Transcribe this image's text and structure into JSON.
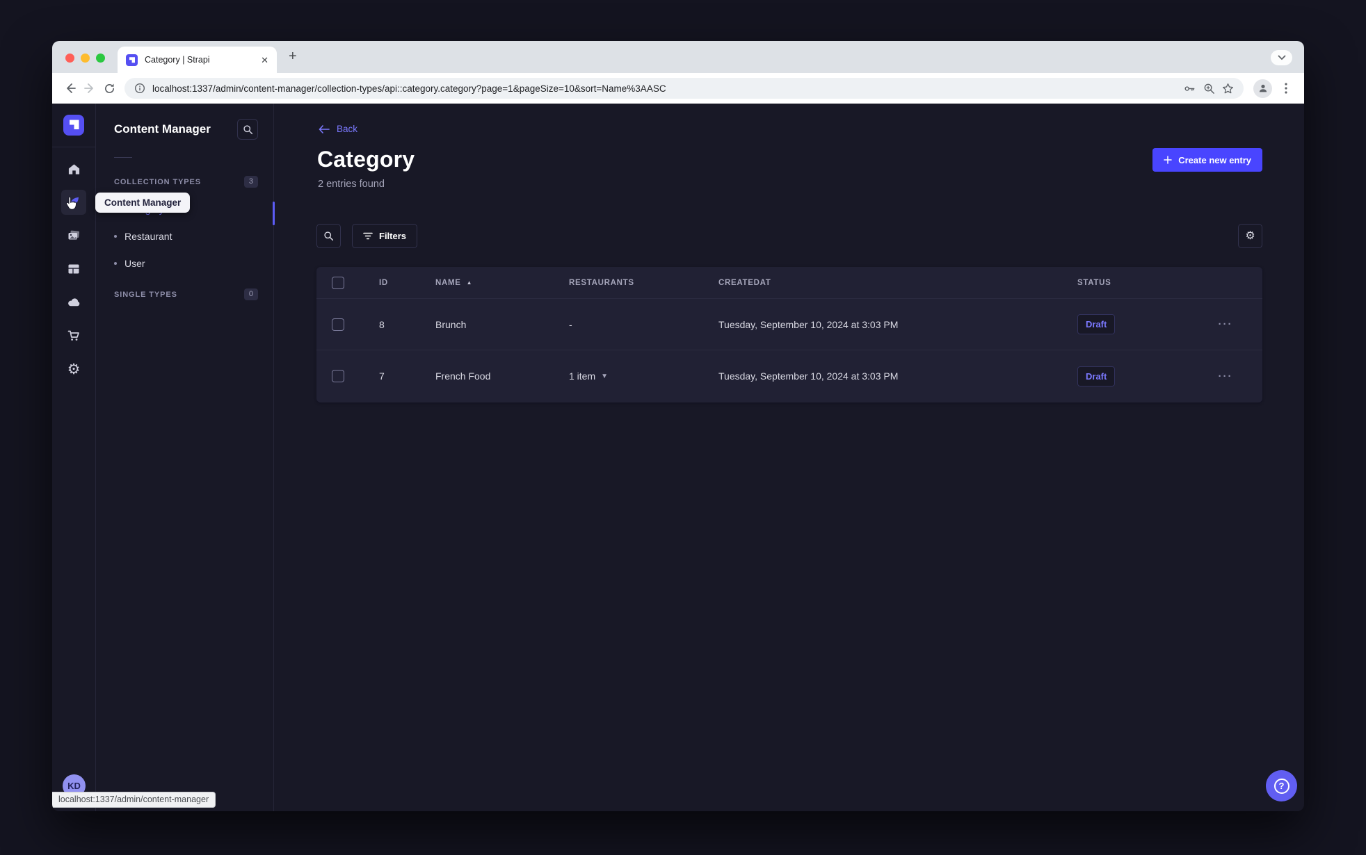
{
  "browser": {
    "tab_title": "Category | Strapi",
    "new_tab_label": "+",
    "close_tab_label": "✕",
    "url": "localhost:1337/admin/content-manager/collection-types/api::category.category?page=1&pageSize=10&sort=Name%3AASC",
    "status_bar_link": "localhost:1337/admin/content-manager"
  },
  "app": {
    "nav_tooltip": "Content Manager",
    "avatar_initials": "KD",
    "help_label": "?"
  },
  "subnav": {
    "title": "Content Manager",
    "sections": [
      {
        "label": "COLLECTION TYPES",
        "badge": "3",
        "items": [
          {
            "label": "Category",
            "active": true
          },
          {
            "label": "Restaurant",
            "active": false
          },
          {
            "label": "User",
            "active": false
          }
        ]
      },
      {
        "label": "SINGLE TYPES",
        "badge": "0",
        "items": []
      }
    ]
  },
  "header": {
    "back_label": "Back",
    "title": "Category",
    "subtitle": "2 entries found",
    "create_button_label": "Create new entry"
  },
  "filters": {
    "filters_label": "Filters"
  },
  "table": {
    "columns": [
      "ID",
      "NAME",
      "RESTAURANTS",
      "CREATEDAT",
      "STATUS"
    ],
    "rows": [
      {
        "id": "8",
        "name": "Brunch",
        "restaurants": "-",
        "createdat": "Tuesday, September 10, 2024 at 3:03 PM",
        "status": "Draft"
      },
      {
        "id": "7",
        "name": "French Food",
        "restaurants": "1 item",
        "createdat": "Tuesday, September 10, 2024 at 3:03 PM",
        "status": "Draft"
      }
    ]
  },
  "colors": {
    "primary": "#4945ff",
    "link": "#7b79ff",
    "app_background": "#181826",
    "card_background": "#212134",
    "draft_text": "#7b79ff"
  }
}
